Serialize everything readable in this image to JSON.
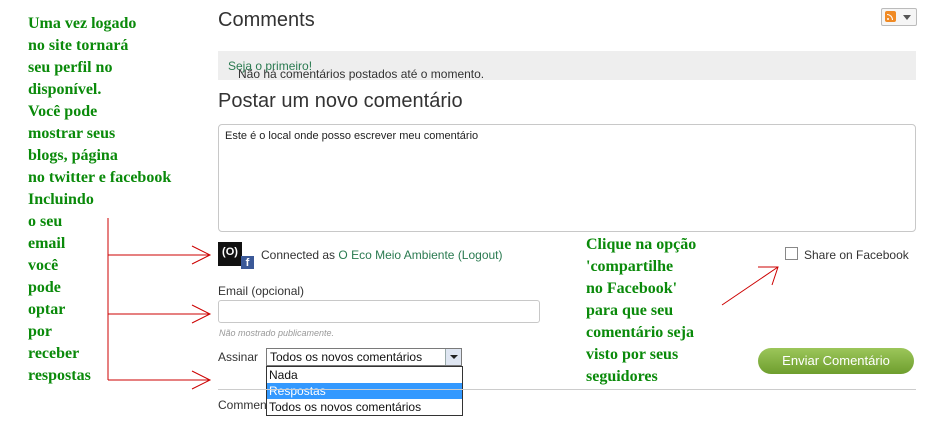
{
  "annotations": {
    "left_lines": [
      "Uma vez logado",
      "no site tornará",
      "seu perfil no",
      "disponível.",
      "Você pode",
      "mostrar seus",
      "blogs, página",
      "no twitter e facebook",
      "Incluindo",
      "o seu",
      "email",
      "você",
      "pode",
      "optar",
      "por",
      "receber",
      "respostas"
    ],
    "right_lines": [
      "Clique na opção",
      "'compartilhe",
      "no Facebook'",
      "para que seu",
      "comentário seja",
      "visto por seus",
      "seguidores"
    ],
    "text_color": "#0a8a0a",
    "arrow_color": "#cc0000"
  },
  "header": {
    "title": "Comments",
    "rss_icon": "rss-icon"
  },
  "notice": {
    "text": "Não há comentários postados até o momento.",
    "link": "Seja o primeiro!"
  },
  "form": {
    "title": "Postar um novo comentário",
    "comment_text": "Este é o local onde posso escrever meu comentário",
    "connected_prefix": "Connected as",
    "connected_user": "O Eco Meio Ambiente",
    "logout": "(Logout)",
    "avatar_text": "(O)",
    "share_label": "Share on Facebook",
    "email_label": "Email (opcional)",
    "email_value": "",
    "email_hint": "Não mostrado publicamente.",
    "subscribe_label": "Assinar",
    "subscribe_selected": "Todos os novos comentários",
    "subscribe_options": [
      "Nada",
      "Respostas",
      "Todos os novos comentários"
    ],
    "submit_label": "Enviar Comentário",
    "comments_cut": "Commen"
  }
}
